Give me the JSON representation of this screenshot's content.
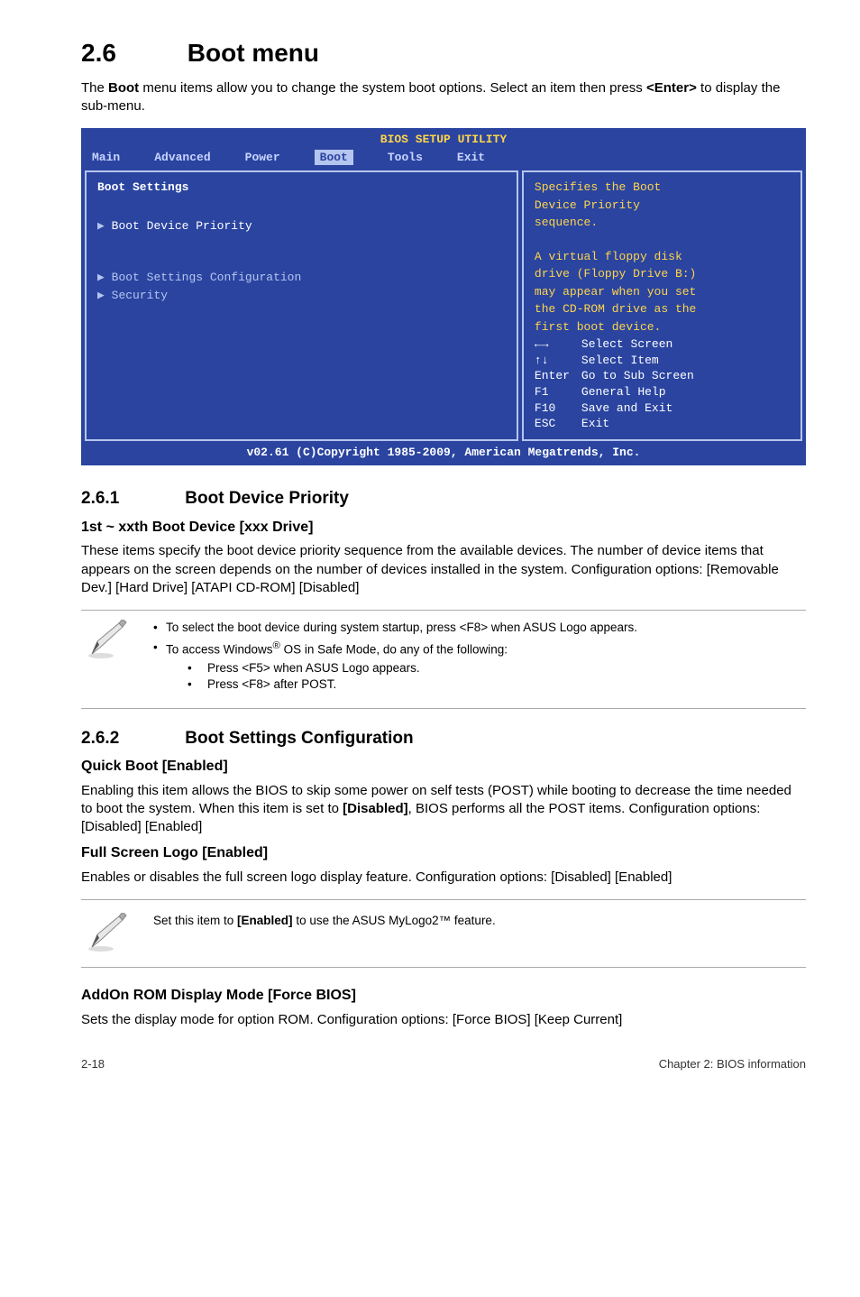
{
  "header": {
    "section_number": "2.6",
    "section_title": "Boot menu",
    "intro_part1": "The ",
    "intro_bold1": "Boot",
    "intro_part2": " menu items allow you to change the system boot options. Select an item then press ",
    "intro_bold2": "<Enter>",
    "intro_part3": " to display the sub-menu."
  },
  "bios": {
    "topbar": "BIOS SETUP UTILITY",
    "menu": {
      "main": "Main",
      "advanced": "Advanced",
      "power": "Power",
      "boot": "Boot",
      "tools": "Tools",
      "exit": "Exit"
    },
    "left": {
      "title": "Boot Settings",
      "item1": "Boot Device Priority",
      "item2": "Boot Settings Configuration",
      "item3": "Security"
    },
    "right": {
      "y1": "Specifies the Boot",
      "y2": "Device Priority",
      "y3": "sequence.",
      "y4": "A virtual floppy disk",
      "y5": "drive (Floppy Drive B:)",
      "y6": "may appear when you set",
      "y7": "the CD-ROM drive as the",
      "y8": "first boot device.",
      "keys": {
        "arrows_lr_key": "←→",
        "arrows_lr_label": "Select Screen",
        "arrows_ud_key": "↑↓",
        "arrows_ud_label": "Select Item",
        "enter_key": "Enter",
        "enter_label": "Go to Sub Screen",
        "f1_key": "F1",
        "f1_label": "General Help",
        "f10_key": "F10",
        "f10_label": "Save and Exit",
        "esc_key": "ESC",
        "esc_label": "Exit"
      }
    },
    "footer": "v02.61 (C)Copyright 1985-2009, American Megatrends, Inc."
  },
  "s261": {
    "num": "2.6.1",
    "title": "Boot Device Priority",
    "h3": "1st ~ xxth Boot Device [xxx Drive]",
    "p": "These items specify the boot device priority sequence from the available devices. The number of device items that appears on the screen depends on the number of devices installed in the system. Configuration options: [Removable Dev.] [Hard Drive] [ATAPI CD-ROM] [Disabled]"
  },
  "note1": {
    "b1": "To select the boot device during system startup, press <F8> when ASUS Logo appears.",
    "b2a": "To access Windows",
    "b2sup": "®",
    "b2b": " OS in Safe Mode, do any of the following:",
    "sub1": "Press <F5> when ASUS Logo appears.",
    "sub2": "Press <F8> after POST."
  },
  "s262": {
    "num": "2.6.2",
    "title": "Boot Settings Configuration",
    "quick_h": "Quick Boot [Enabled]",
    "quick_p1": "Enabling this item allows the BIOS to skip some power on self tests (POST) while booting to decrease the time needed to boot the system. When this item is set to ",
    "quick_bold": "[Disabled]",
    "quick_p2": ", BIOS performs all the POST items. Configuration options: [Disabled] [Enabled]",
    "full_h": "Full Screen Logo [Enabled]",
    "full_p": "Enables or disables the full screen logo display feature. Configuration options: [Disabled] [Enabled]"
  },
  "note2": {
    "t1": "Set this item to ",
    "bold": "[Enabled]",
    "t2": " to use the ASUS MyLogo2™ feature."
  },
  "addon": {
    "h": "AddOn ROM Display Mode [Force BIOS]",
    "p": "Sets the display mode for option ROM. Configuration options: [Force BIOS] [Keep Current]"
  },
  "footer": {
    "left": "2-18",
    "right": "Chapter 2: BIOS information"
  }
}
